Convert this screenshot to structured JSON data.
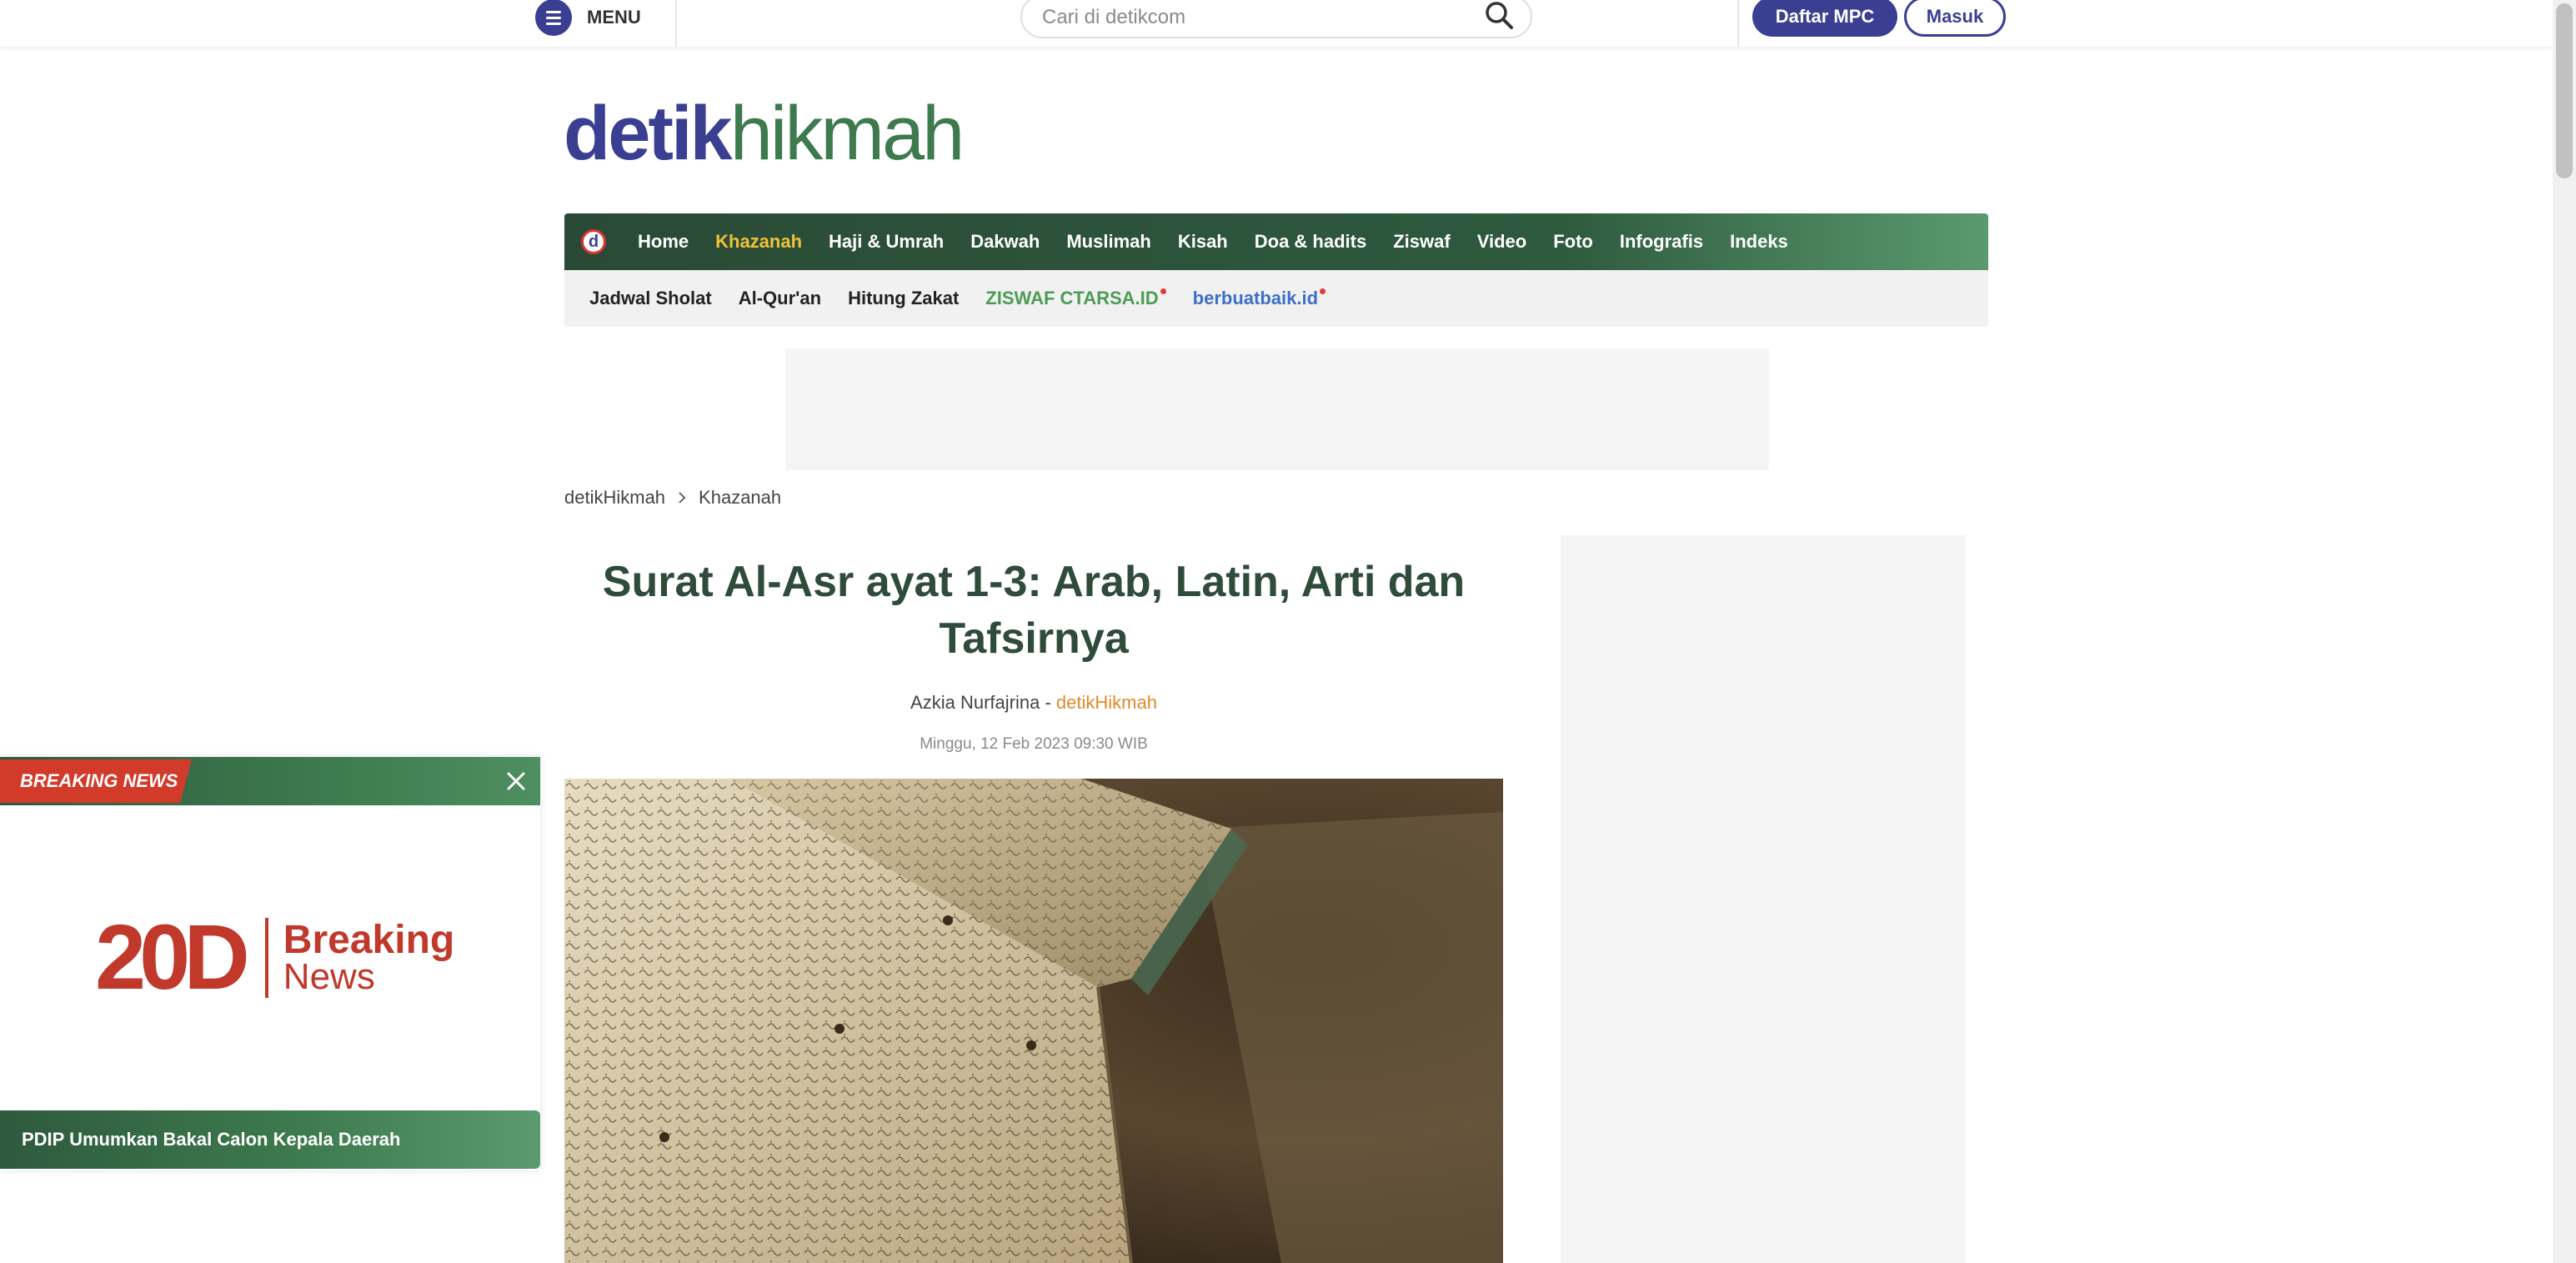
{
  "header": {
    "menu_label": "MENU",
    "search_placeholder": "Cari di detikcom",
    "register_label": "Daftar MPC",
    "login_label": "Masuk"
  },
  "logo": {
    "part1": "detik",
    "part2": "hikmah"
  },
  "nav_primary": [
    {
      "label": "Home",
      "active": false
    },
    {
      "label": "Khazanah",
      "active": true
    },
    {
      "label": "Haji & Umrah",
      "active": false
    },
    {
      "label": "Dakwah",
      "active": false
    },
    {
      "label": "Muslimah",
      "active": false
    },
    {
      "label": "Kisah",
      "active": false
    },
    {
      "label": "Doa & hadits",
      "active": false
    },
    {
      "label": "Ziswaf",
      "active": false
    },
    {
      "label": "Video",
      "active": false
    },
    {
      "label": "Foto",
      "active": false
    },
    {
      "label": "Infografis",
      "active": false
    },
    {
      "label": "Indeks",
      "active": false
    }
  ],
  "nav_secondary": [
    {
      "label": "Jadwal Sholat"
    },
    {
      "label": "Al-Qur'an"
    },
    {
      "label": "Hitung Zakat"
    },
    {
      "label": "ZISWAF CTARSA.ID"
    },
    {
      "label": "berbuatbaik.id"
    }
  ],
  "breadcrumb": {
    "root": "detikHikmah",
    "current": "Khazanah"
  },
  "article": {
    "title": "Surat Al-Asr ayat 1-3: Arab, Latin, Arti dan Tafsirnya",
    "author": "Azkia Nurfajrina",
    "separator": " - ",
    "source": "detikHikmah",
    "date": "Minggu, 12 Feb 2023 09:30 WIB"
  },
  "breaking_news": {
    "label": "BREAKING NEWS",
    "logo_number": "20D",
    "logo_word1": "Breaking",
    "logo_word2": "News",
    "headline": "PDIP Umumkan Bakal Calon Kepala Daerah"
  },
  "colors": {
    "brand_blue": "#3a3f92",
    "brand_green": "#3d7a4d",
    "active_nav": "#f0c23b",
    "breaking_red": "#d23a2a",
    "source_orange": "#e08a2c"
  },
  "icons": {
    "menu": "hamburger-icon",
    "search": "search-icon",
    "detik": "detik-d-icon",
    "breadcrumb_sep": "chevron-right-icon",
    "close": "close-icon"
  }
}
